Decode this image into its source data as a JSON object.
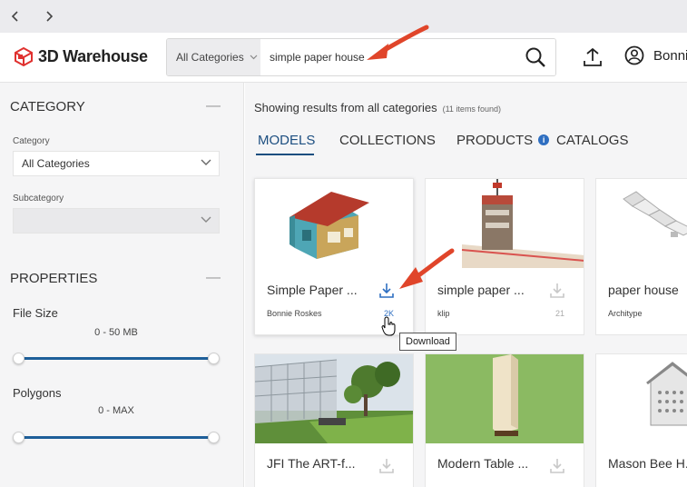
{
  "browser": {
    "back_icon": "chevron-left-icon",
    "forward_icon": "chevron-right-icon"
  },
  "header": {
    "logo_text": "3D Warehouse",
    "category_select": "All Categories",
    "search_value": "simple paper house",
    "user_name": "Bonnie",
    "accent_color": "#e0312f"
  },
  "sidebar": {
    "category_heading": "CATEGORY",
    "category_label": "Category",
    "category_value": "All Categories",
    "subcategory_label": "Subcategory",
    "subcategory_value": "",
    "properties_heading": "PROPERTIES",
    "file_size_label": "File Size",
    "file_size_range": "0 - 50 MB",
    "polygons_label": "Polygons",
    "polygons_range": "0 - MAX",
    "slider_color": "#1e5f99"
  },
  "main": {
    "results_text": "Showing results from all categories",
    "results_count": "(11 items found)",
    "tabs": [
      {
        "label": "MODELS",
        "active": true
      },
      {
        "label": "COLLECTIONS",
        "active": false
      },
      {
        "label": "PRODUCTS",
        "active": false
      },
      {
        "label": "CATALOGS",
        "active": false
      }
    ],
    "cards": [
      {
        "title": "Simple Paper ...",
        "author": "Bonnie Roskes",
        "downloads": "2K"
      },
      {
        "title": "simple paper ...",
        "author": "klip",
        "downloads": "21"
      },
      {
        "title": "paper house",
        "author": "Architype",
        "downloads": ""
      },
      {
        "title": "JFI The ART-f...",
        "author": "",
        "downloads": ""
      },
      {
        "title": "Modern Table ...",
        "author": "",
        "downloads": ""
      },
      {
        "title": "Mason Bee H...",
        "author": "",
        "downloads": ""
      }
    ],
    "tooltip": "Download"
  }
}
